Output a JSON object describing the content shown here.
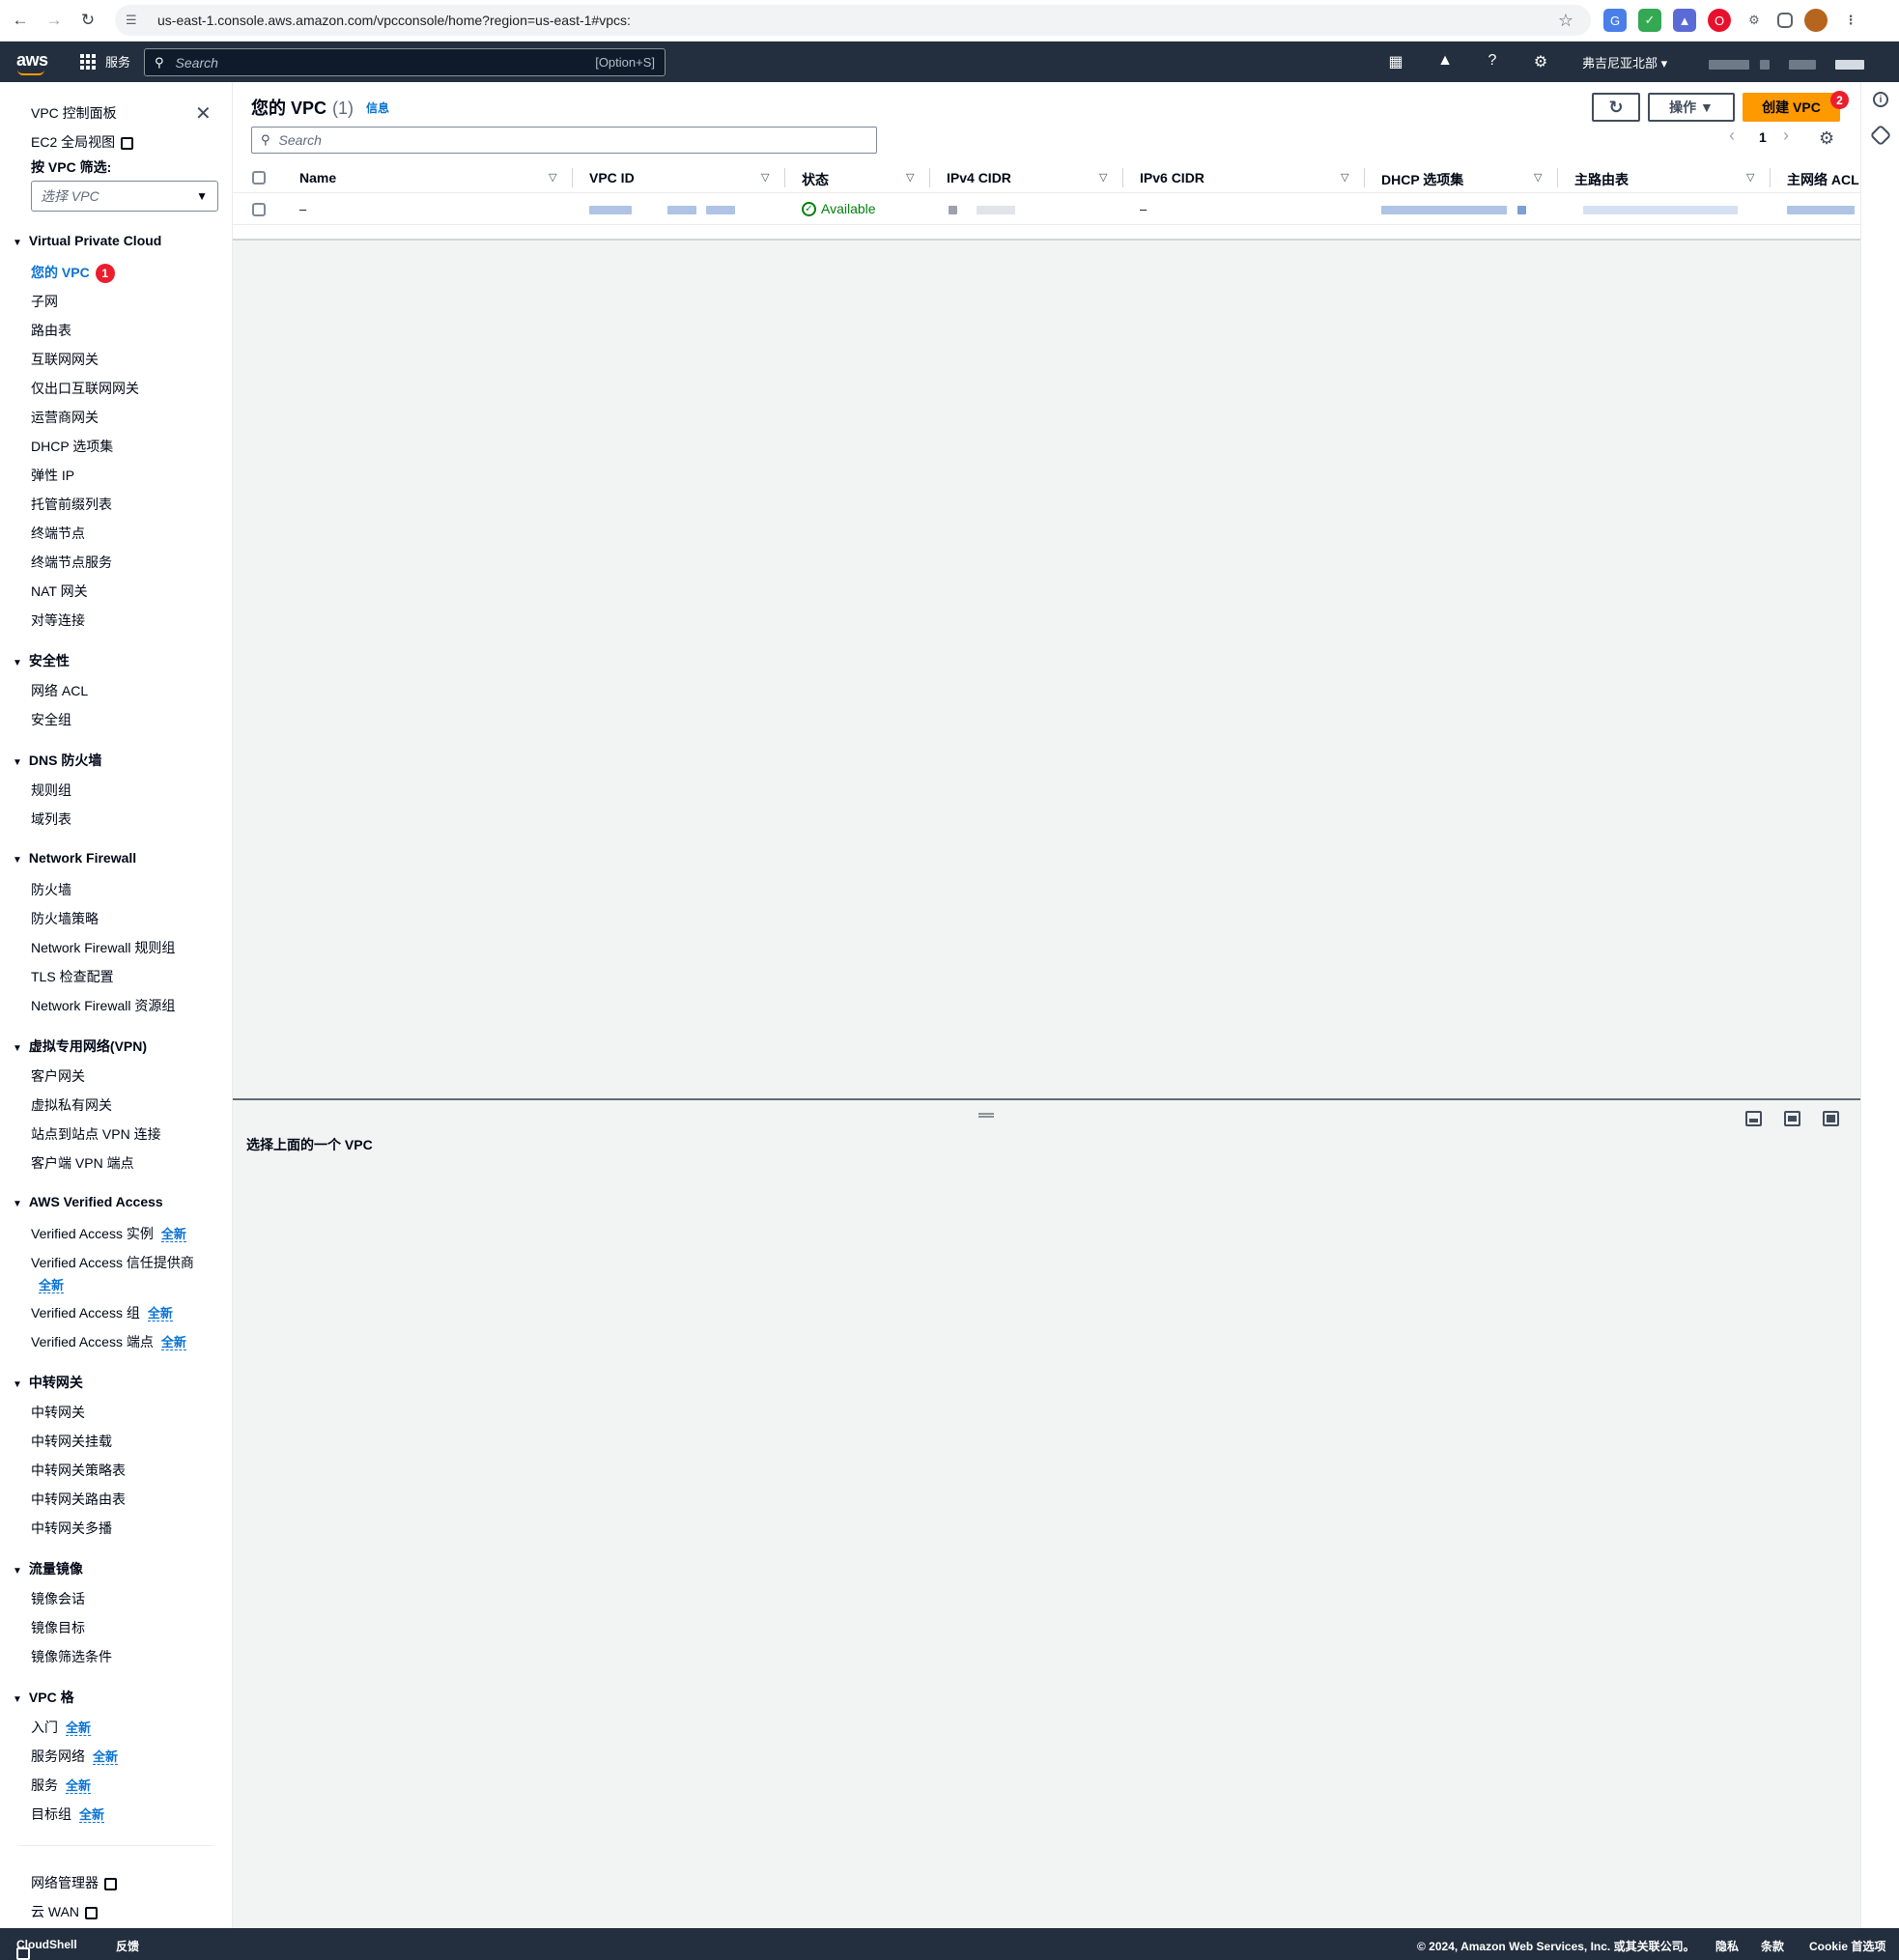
{
  "browser": {
    "url": "us-east-1.console.aws.amazon.com/vpcconsole/home?region=us-east-1#vpcs:"
  },
  "aws_nav": {
    "logo": "aws",
    "services": "服务",
    "search_placeholder": "Search",
    "search_shortcut": "[Option+S]",
    "region": "弗吉尼亚北部 ▾"
  },
  "sidebar": {
    "dashboard": "VPC 控制面板",
    "ec2_global": "EC2 全局视图",
    "filter_label": "按 VPC 筛选:",
    "filter_placeholder": "选择 VPC",
    "sections": {
      "vpc": "Virtual Private Cloud",
      "security": "安全性",
      "dns_firewall": "DNS 防火墙",
      "network_firewall": "Network Firewall",
      "vpn": "虚拟专用网络(VPN)",
      "verified_access": "AWS Verified Access",
      "transit": "中转网关",
      "mirror": "流量镜像",
      "lattice": "VPC 格"
    },
    "vpc_items": [
      "您的 VPC",
      "子网",
      "路由表",
      "互联网网关",
      "仅出口互联网网关",
      "运营商网关",
      "DHCP 选项集",
      "弹性 IP",
      "托管前缀列表",
      "终端节点",
      "终端节点服务",
      "NAT 网关",
      "对等连接"
    ],
    "vpc_badge": "1",
    "security_items": [
      "网络 ACL",
      "安全组"
    ],
    "dns_items": [
      "规则组",
      "域列表"
    ],
    "nfw_items": [
      "防火墙",
      "防火墙策略",
      "Network Firewall 规则组",
      "TLS 检查配置",
      "Network Firewall 资源组"
    ],
    "vpn_items": [
      "客户网关",
      "虚拟私有网关",
      "站点到站点 VPN 连接",
      "客户端 VPN 端点"
    ],
    "va_items": [
      "Verified Access 实例",
      "Verified Access 信任提供商",
      "Verified Access 组",
      "Verified Access 端点"
    ],
    "new_label": "全新",
    "transit_items": [
      "中转网关",
      "中转网关挂载",
      "中转网关策略表",
      "中转网关路由表",
      "中转网关多播"
    ],
    "mirror_items": [
      "镜像会话",
      "镜像目标",
      "镜像筛选条件"
    ],
    "lattice_items": [
      "入门",
      "服务网络",
      "服务",
      "目标组"
    ],
    "bottom_items": [
      "网络管理器",
      "云 WAN"
    ]
  },
  "main": {
    "title": "您的 VPC",
    "count": "(1)",
    "info": "信息",
    "actions": "操作 ▼",
    "create": "创建 VPC",
    "create_badge": "2",
    "search_placeholder": "Search",
    "page": "1",
    "columns": [
      "Name",
      "VPC ID",
      "状态",
      "IPv4 CIDR",
      "IPv6 CIDR",
      "DHCP 选项集",
      "主路由表",
      "主网络 ACL"
    ],
    "row": {
      "name": "–",
      "status": "Available",
      "ipv6": "–"
    },
    "select_message": "选择上面的一个 VPC"
  },
  "footer": {
    "cloudshell": "CloudShell",
    "feedback": "反馈",
    "copyright": "© 2024, Amazon Web Services, Inc. 或其关联公司。",
    "privacy": "隐私",
    "terms": "条款",
    "cookies": "Cookie 首选项"
  },
  "colors": {
    "aws_nav": "#232f3e",
    "primary_button": "#ff9900",
    "link": "#0972d3",
    "success": "#037f0c",
    "badge": "#eb1e2e"
  }
}
